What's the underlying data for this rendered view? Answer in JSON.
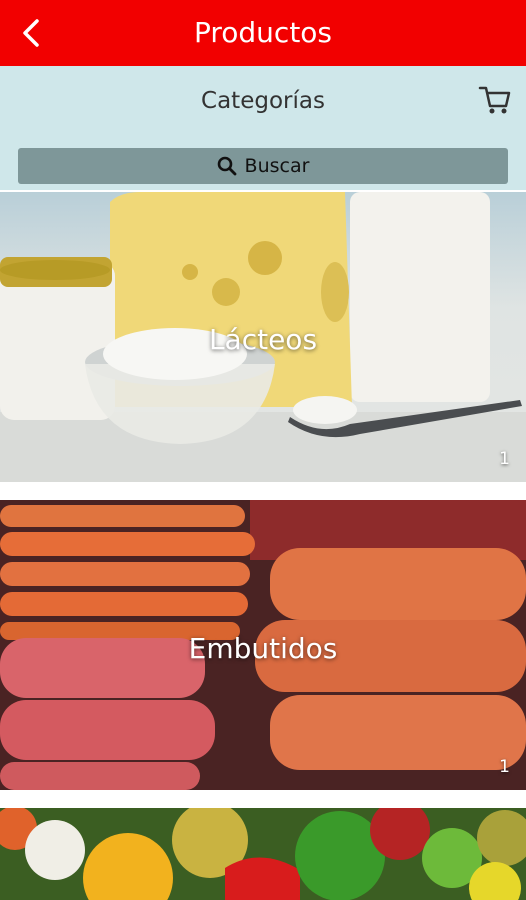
{
  "header": {
    "title": "Productos"
  },
  "subheader": {
    "title": "Categorías"
  },
  "search": {
    "label": "Buscar"
  },
  "categories": [
    {
      "name": "Lácteos",
      "count": "1"
    },
    {
      "name": "Embutidos",
      "count": "1"
    }
  ],
  "colors": {
    "topbar": "#f20000",
    "subbar": "#cfe7ea",
    "search_bg": "#7e9799"
  }
}
